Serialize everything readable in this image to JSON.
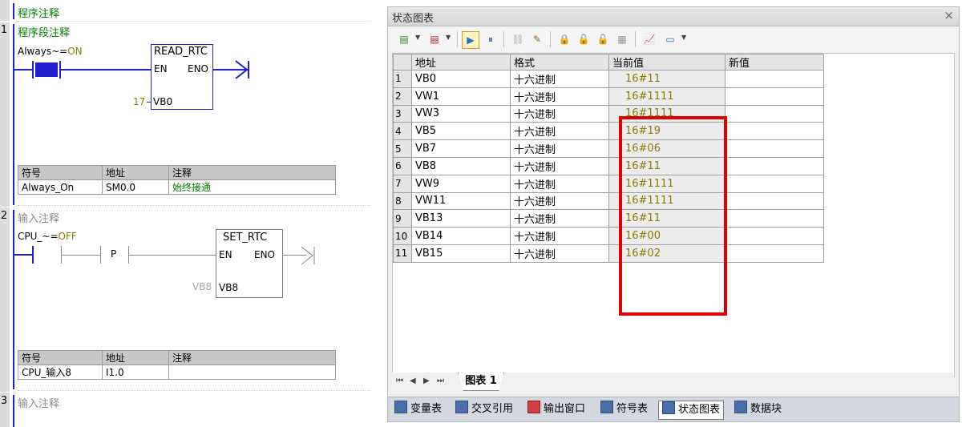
{
  "ladder": {
    "network0": {
      "comment": "程序注释"
    },
    "network1": {
      "number": "1",
      "comment": "程序段注释",
      "contact": {
        "symbol": "Always~",
        "eq": "=",
        "state": "ON"
      },
      "block": {
        "name": "READ_RTC",
        "en": "EN",
        "eno": "ENO",
        "param_value": "17",
        "param": "VB0"
      },
      "symbols": {
        "headers": [
          "符号",
          "地址",
          "注释"
        ],
        "rows": [
          [
            "Always_On",
            "SM0.0",
            "始终接通"
          ]
        ]
      }
    },
    "network2": {
      "number": "2",
      "comment": "输入注释",
      "contact": {
        "symbol": "CPU_~",
        "eq": "=",
        "state": "OFF"
      },
      "p_contact": "P",
      "block": {
        "name": "SET_RTC",
        "en": "EN",
        "eno": "ENO",
        "param_value": "VB8",
        "param": "VB8"
      },
      "symbols": {
        "headers": [
          "符号",
          "地址",
          "注释"
        ],
        "rows": [
          [
            "CPU_输入8",
            "I1.0",
            ""
          ]
        ]
      }
    },
    "network3": {
      "number": "3",
      "comment": "输入注释"
    }
  },
  "status_chart": {
    "title": "状态图表",
    "close": "×",
    "headers": [
      "地址",
      "格式",
      "当前值",
      "新值"
    ],
    "rows": [
      {
        "n": "1",
        "addr": "VB0",
        "fmt": "十六进制",
        "cur": "16#11",
        "new": ""
      },
      {
        "n": "2",
        "addr": "VW1",
        "fmt": "十六进制",
        "cur": "16#1111",
        "new": ""
      },
      {
        "n": "3",
        "addr": "VW3",
        "fmt": "十六进制",
        "cur": "16#1111",
        "new": ""
      },
      {
        "n": "4",
        "addr": "VB5",
        "fmt": "十六进制",
        "cur": "16#19",
        "new": ""
      },
      {
        "n": "5",
        "addr": "VB7",
        "fmt": "十六进制",
        "cur": "16#06",
        "new": ""
      },
      {
        "n": "6",
        "addr": "VB8",
        "fmt": "十六进制",
        "cur": "16#11",
        "new": ""
      },
      {
        "n": "7",
        "addr": "VW9",
        "fmt": "十六进制",
        "cur": "16#1111",
        "new": ""
      },
      {
        "n": "8",
        "addr": "VW11",
        "fmt": "十六进制",
        "cur": "16#1111",
        "new": ""
      },
      {
        "n": "9",
        "addr": "VB13",
        "fmt": "十六进制",
        "cur": "16#11",
        "new": ""
      },
      {
        "n": "10",
        "addr": "VB14",
        "fmt": "十六进制",
        "cur": "16#00",
        "new": ""
      },
      {
        "n": "11",
        "addr": "VB15",
        "fmt": "十六进制",
        "cur": "16#02",
        "new": ""
      }
    ],
    "sheet_tab": "图表 1",
    "nav": [
      "⏮",
      "◀",
      "▶",
      "⏭"
    ],
    "toolbar_icons": [
      "insert-row-icon",
      "delete-row-icon",
      "chart-execution-icon",
      "pause-icon",
      "read-icon",
      "write-icon",
      "force-icon",
      "unforce-icon",
      "unforce-all-icon",
      "read-all-forced-icon",
      "trend-view-icon",
      "tag-icon"
    ]
  },
  "bottom_tabs": [
    "变量表",
    "交叉引用",
    "输出窗口",
    "符号表",
    "状态图表",
    "数据块"
  ],
  "bottom_active": "状态图表",
  "colors": {
    "rail": "#1f1fd0",
    "green_text": "#008000",
    "olive_text": "#8a7a00",
    "highlight": "#e00000"
  }
}
